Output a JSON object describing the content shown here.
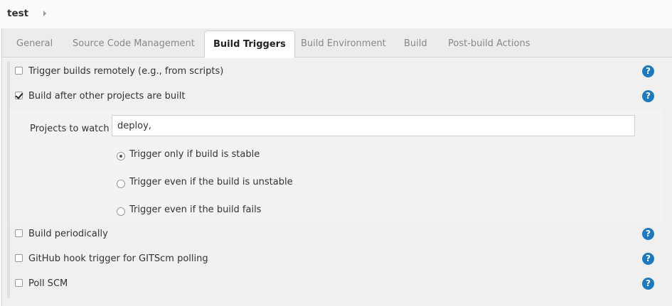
{
  "breadcrumb": {
    "title": "test"
  },
  "tabs": [
    {
      "label": "General",
      "active": false
    },
    {
      "label": "Source Code Management",
      "active": false
    },
    {
      "label": "Build Triggers",
      "active": true
    },
    {
      "label": "Build Environment",
      "active": false
    },
    {
      "label": "Build",
      "active": false
    },
    {
      "label": "Post-build Actions",
      "active": false
    }
  ],
  "triggers": {
    "remote": {
      "label": "Trigger builds remotely (e.g., from scripts)",
      "checked": false
    },
    "after_other": {
      "label": "Build after other projects are built",
      "checked": true
    },
    "periodic": {
      "label": "Build periodically",
      "checked": false
    },
    "github_hook": {
      "label": "GitHub hook trigger for GITScm polling",
      "checked": false
    },
    "poll_scm": {
      "label": "Poll SCM",
      "checked": false
    }
  },
  "after_other_config": {
    "projects_label": "Projects to watch",
    "projects_value": "deploy,",
    "options": [
      {
        "label": "Trigger only if build is stable",
        "selected": true
      },
      {
        "label": "Trigger even if the build is unstable",
        "selected": false
      },
      {
        "label": "Trigger even if the build fails",
        "selected": false
      }
    ]
  },
  "help_glyph": "?",
  "colors": {
    "help_icon": "#1e7ac0",
    "active_tab_bg": "#ffffff"
  }
}
